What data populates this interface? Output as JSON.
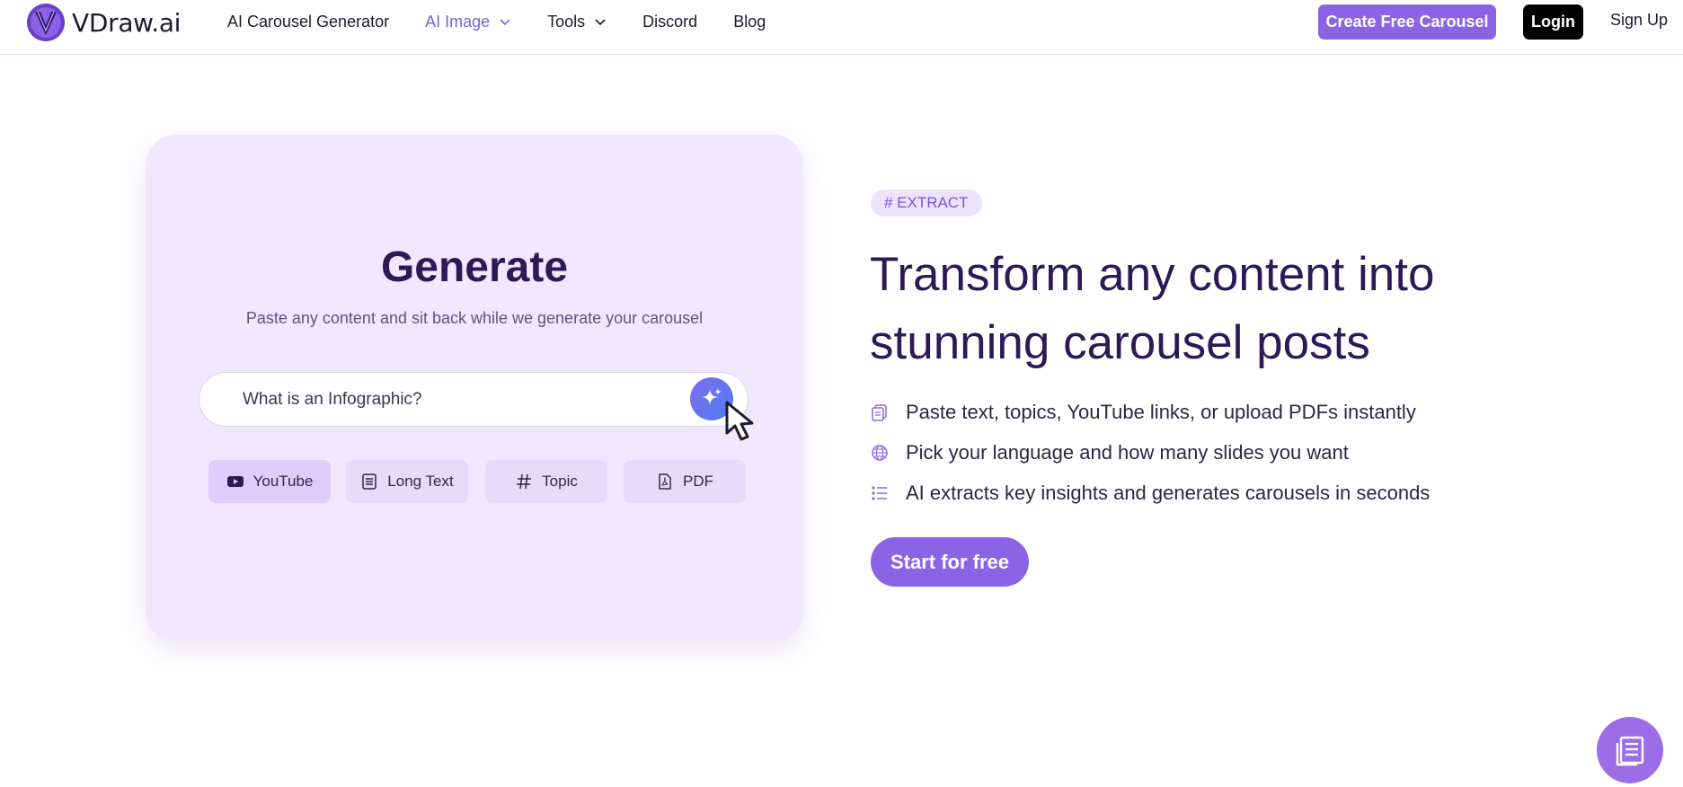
{
  "nav": {
    "brand": "VDraw.ai",
    "links": [
      {
        "label": "AI Carousel Generator"
      },
      {
        "label": "AI Image"
      },
      {
        "label": "Tools"
      },
      {
        "label": "Discord"
      },
      {
        "label": "Blog"
      }
    ],
    "create_label": "Create Free Carousel",
    "login_label": "Login",
    "signup_label": "Sign Up"
  },
  "generator": {
    "title": "Generate",
    "subtitle": "Paste any content and sit back while we generate your carousel",
    "input_value": "What is an Infographic?",
    "types": [
      {
        "label": "YouTube",
        "icon": "youtube-icon"
      },
      {
        "label": "Long Text",
        "icon": "document-icon"
      },
      {
        "label": "Topic",
        "icon": "hashtag-icon"
      },
      {
        "label": "PDF",
        "icon": "pdf-icon"
      }
    ]
  },
  "feature_section": {
    "badge": "# EXTRACT",
    "headline_line1": "Transform any content into",
    "headline_line2": "stunning carousel posts",
    "features": [
      {
        "text": "Paste text, topics, YouTube links, or upload PDFs instantly",
        "icon": "copy-icon"
      },
      {
        "text": "Pick your language and how many slides you want",
        "icon": "globe-icon"
      },
      {
        "text": "AI extracts key insights and generates carousels in seconds",
        "icon": "list-icon"
      }
    ],
    "cta_label": "Start for free"
  },
  "colors": {
    "accent": "#8b64e6",
    "heading": "#2c1a57",
    "card_bg": "#efe8fe"
  }
}
